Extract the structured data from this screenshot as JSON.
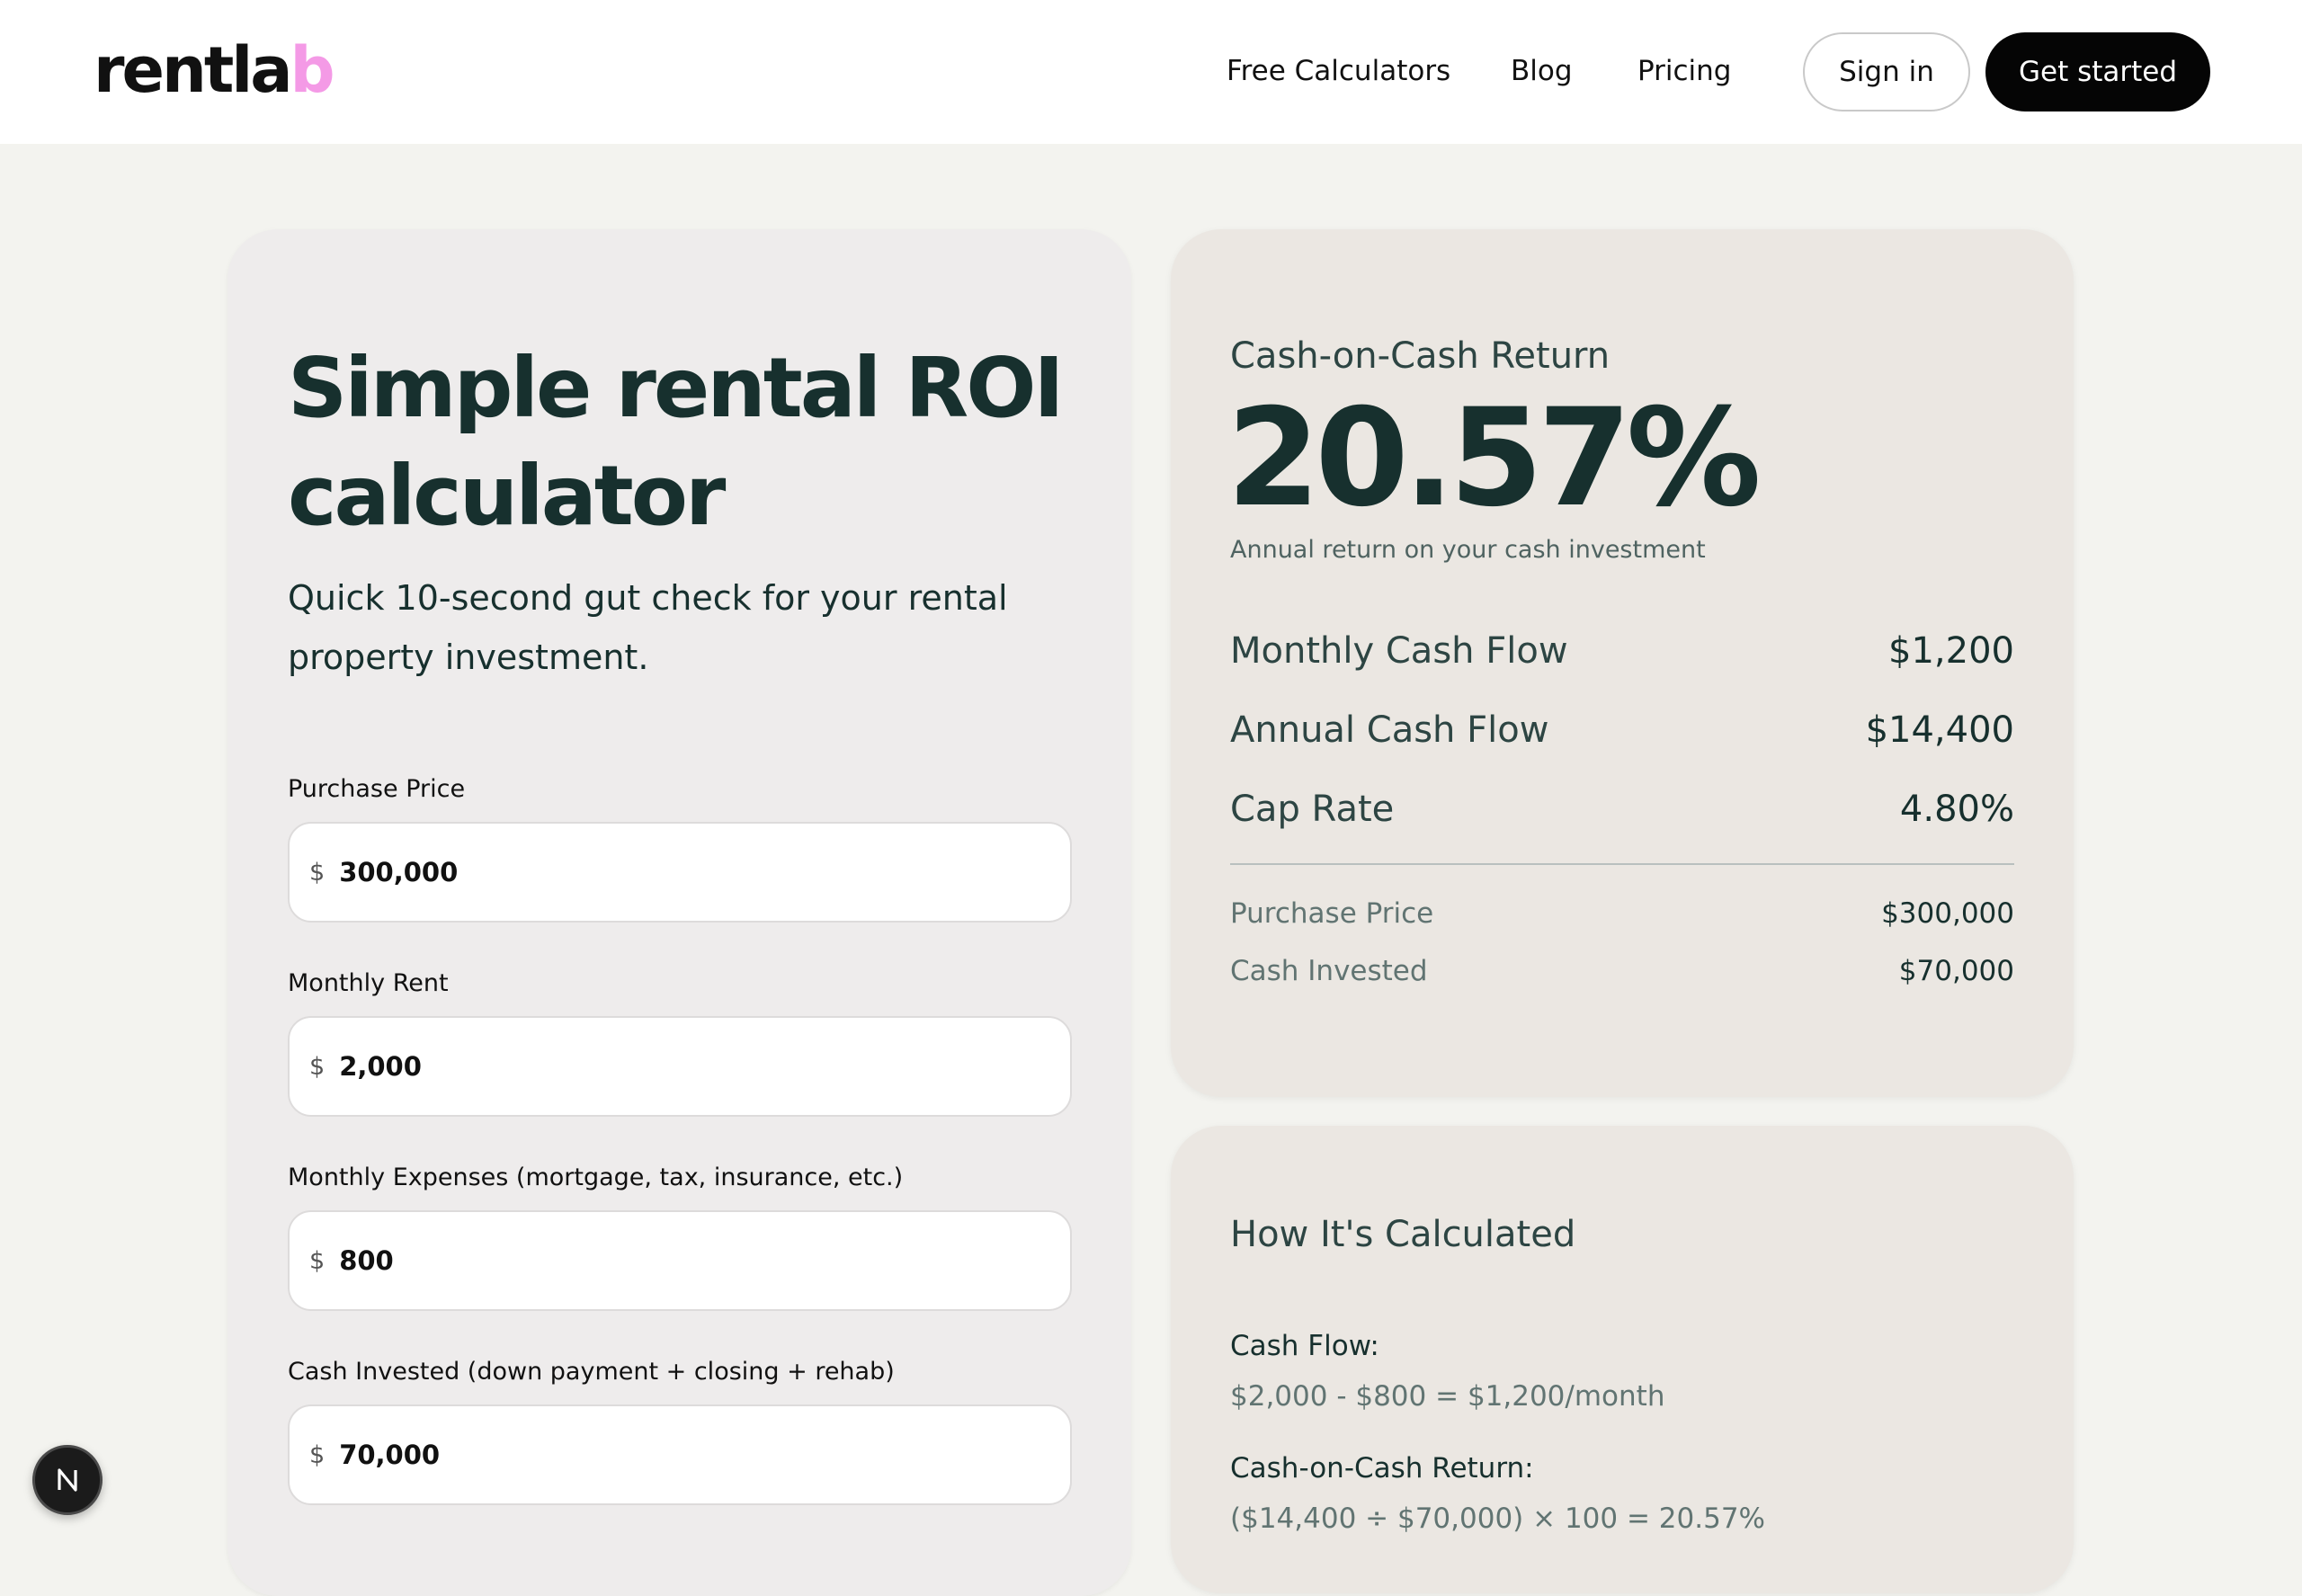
{
  "header": {
    "logo_main": "rentla",
    "logo_accent": "b",
    "nav": [
      "Free Calculators",
      "Blog",
      "Pricing"
    ],
    "sign_in": "Sign in",
    "get_started": "Get started"
  },
  "calculator": {
    "title": "Simple rental ROI calculator",
    "subtitle": "Quick 10-second gut check for your rental property investment.",
    "currency_symbol": "$",
    "fields": [
      {
        "label": "Purchase Price",
        "value": "300,000"
      },
      {
        "label": "Monthly Rent",
        "value": "2,000"
      },
      {
        "label": "Monthly Expenses (mortgage, tax, insurance, etc.)",
        "value": "800"
      },
      {
        "label": "Cash Invested (down payment + closing + rehab)",
        "value": "70,000"
      }
    ]
  },
  "results": {
    "title": "Cash-on-Cash Return",
    "value": "20.57%",
    "caption": "Annual return on your cash investment",
    "metrics": [
      {
        "label": "Monthly Cash Flow",
        "value": "$1,200"
      },
      {
        "label": "Annual Cash Flow",
        "value": "$14,400"
      },
      {
        "label": "Cap Rate",
        "value": "4.80%"
      }
    ],
    "details": [
      {
        "label": "Purchase Price",
        "value": "$300,000"
      },
      {
        "label": "Cash Invested",
        "value": "$70,000"
      }
    ]
  },
  "how": {
    "title": "How It's Calculated",
    "items": [
      {
        "label": "Cash Flow:",
        "formula": "$2,000 - $800 = $1,200/month"
      },
      {
        "label": "Cash-on-Cash Return:",
        "formula": "($14,400 ÷ $70,000) × 100 = 20.57%"
      }
    ]
  },
  "badge": {
    "letter": "N"
  },
  "colors": {
    "page_bg": "#f3f3ef",
    "text_dark": "#17302e",
    "logo_accent": "#f49ae6",
    "button_dark": "#050505"
  }
}
